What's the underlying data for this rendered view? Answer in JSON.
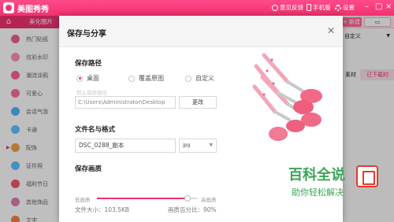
{
  "app": {
    "title": "美图秀秀",
    "feedback": "意见反馈",
    "mobile": "手机版",
    "settings": "设置",
    "colors": {
      "brand": "#f0326f",
      "watermark": "#3aa655"
    }
  },
  "tabs": {
    "active": "美化图片",
    "new_label": "+ 新建",
    "open_label": "已下载的"
  },
  "sidebar": {
    "items": [
      {
        "label": "热门贴纸",
        "color": "#f25f8b"
      },
      {
        "label": "炫彩水印",
        "color": "#ff8fb3"
      },
      {
        "label": "潮流涂鸦",
        "color": "#ff5fa0"
      },
      {
        "label": "可爱心",
        "color": "#ff6f9b"
      },
      {
        "label": "会话气泡",
        "color": "#4fb3ff"
      },
      {
        "label": "卡通",
        "color": "#5fc4ff"
      },
      {
        "label": "配饰",
        "color": "#f4a24a"
      },
      {
        "label": "证件照",
        "color": "#5ec2ff"
      },
      {
        "label": "福利节日",
        "color": "#f5556f"
      },
      {
        "label": "其他饰品",
        "color": "#e07bb2"
      },
      {
        "label": "文字",
        "color": "#ff7f3f"
      }
    ]
  },
  "right_panel": {
    "select_value": "自定义",
    "tab_left": "素材",
    "tab_right": "已下载的"
  },
  "dialog": {
    "title": "保存与分享",
    "path_section": "保存路径",
    "radios": [
      {
        "label": "桌面",
        "checked": true
      },
      {
        "label": "覆盖原图",
        "checked": false
      },
      {
        "label": "自定义",
        "checked": false
      }
    ],
    "default_hint": "默认保存路径",
    "path_value": "C:\\Users\\Administrator\\Desktop",
    "change_label": "更改",
    "name_section": "文件名与格式",
    "file_name": "DSC_0288_副本",
    "format": "jpg",
    "quality_section": "保存画质",
    "quality_low": "低画质",
    "quality_high": "高画质",
    "quality_value": 0.9,
    "file_size": "文件大小：103.5KB",
    "percent": "画质百分比：90%"
  },
  "watermark": {
    "title": "百科全说",
    "subtitle": "助你轻松解决"
  }
}
